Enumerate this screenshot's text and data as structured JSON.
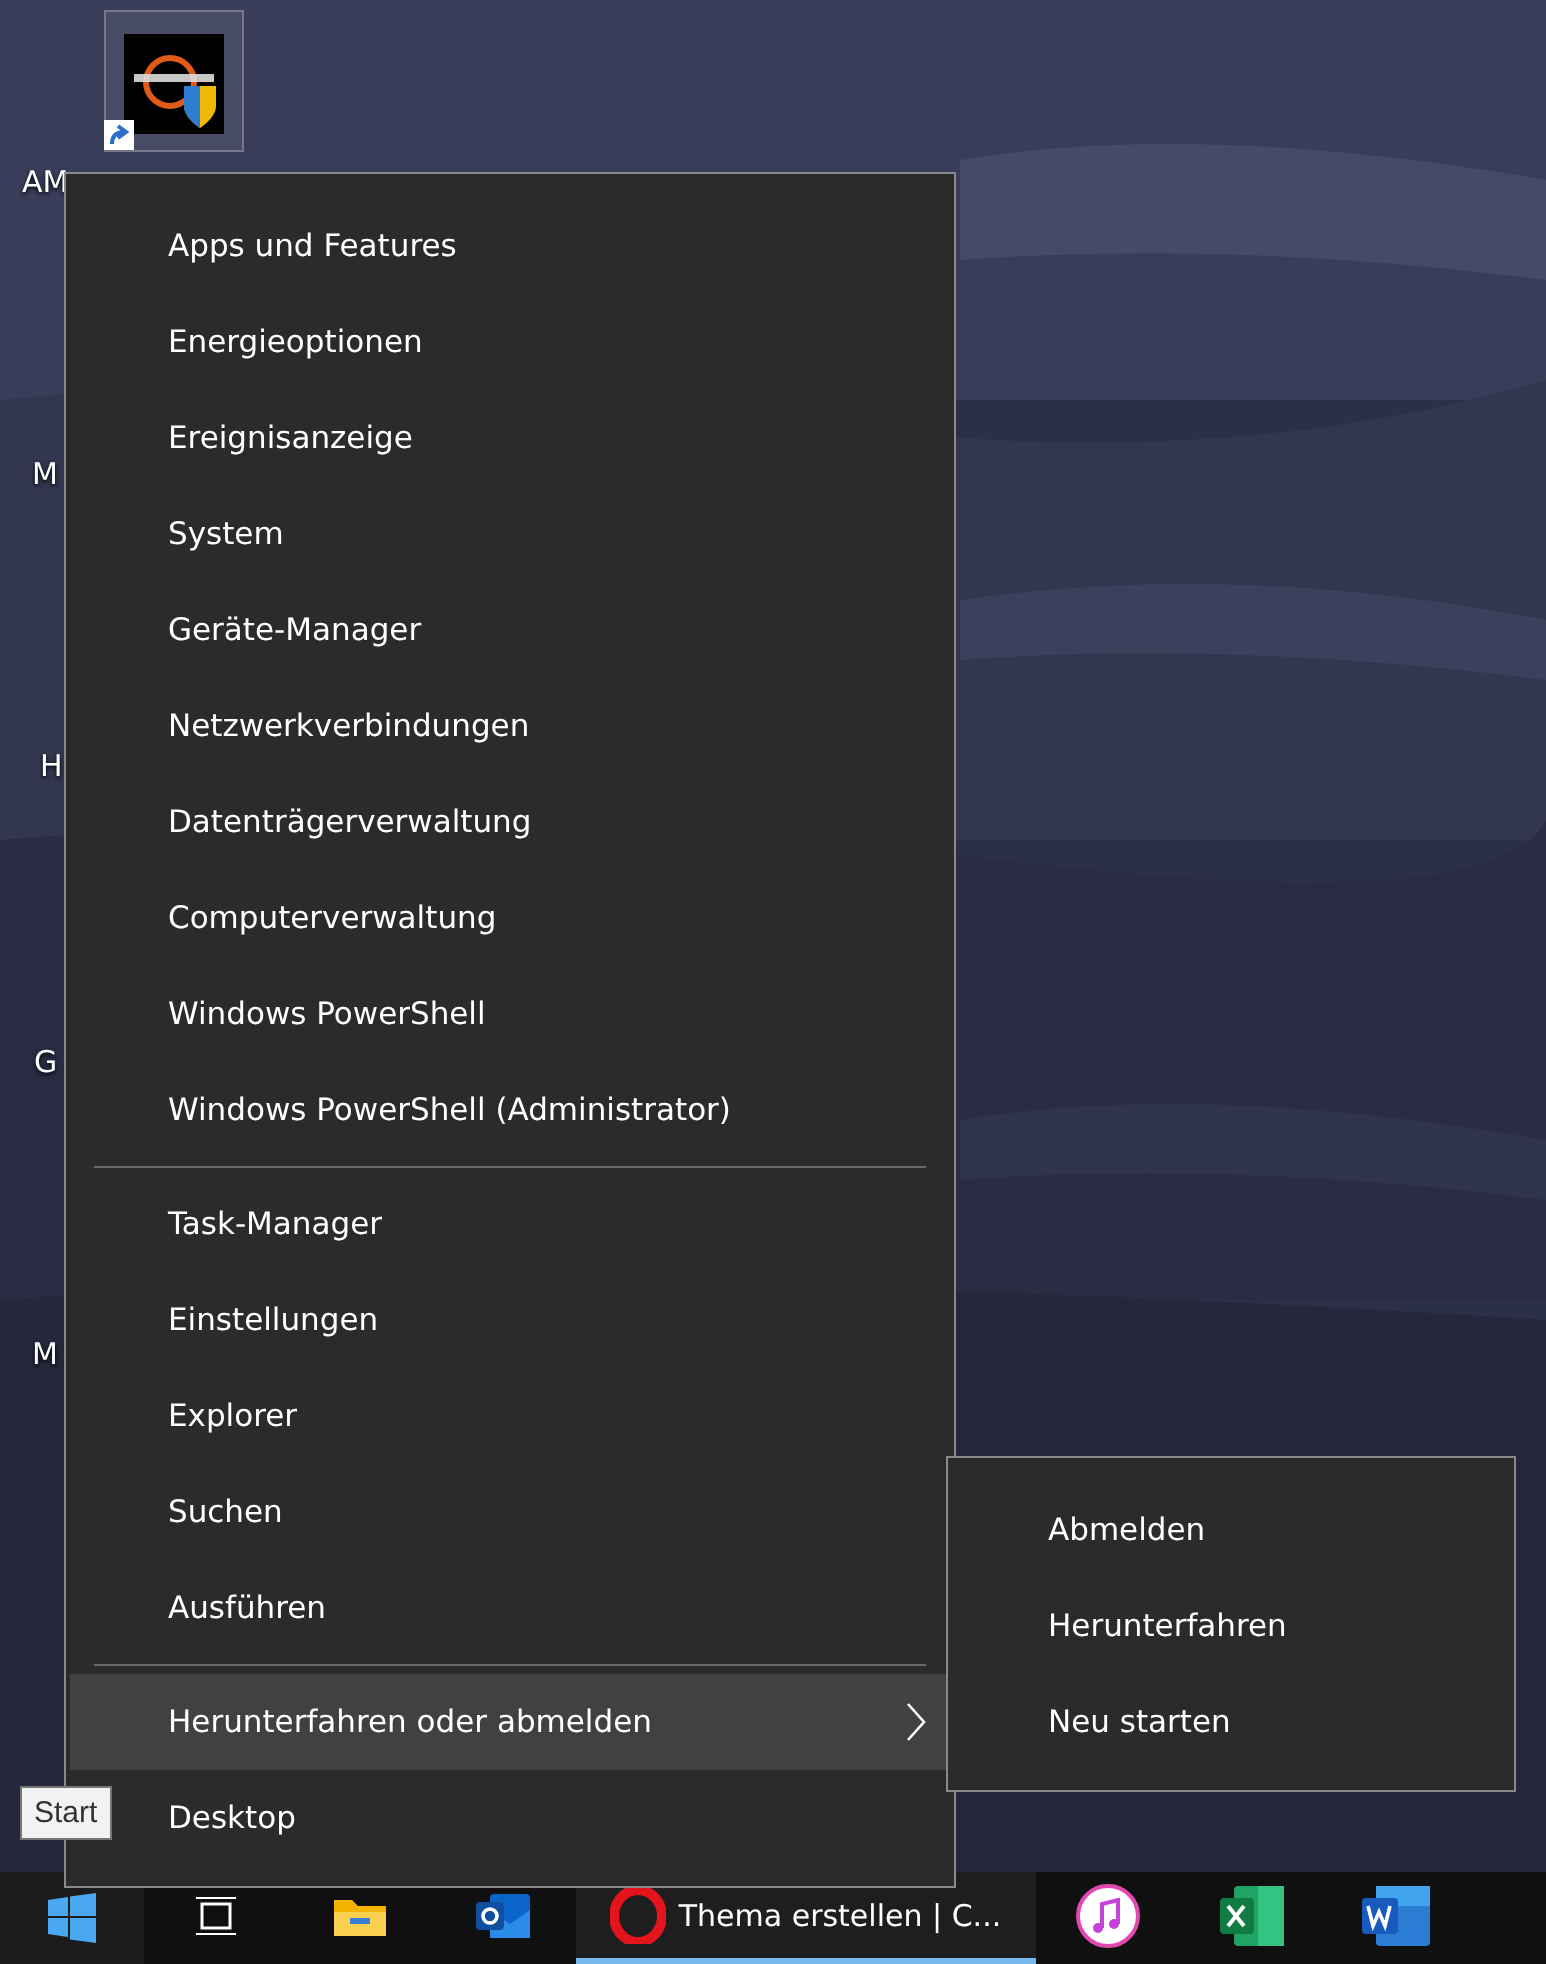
{
  "desktop": {
    "icon_labels": [
      {
        "label": "AM"
      },
      {
        "label": "M"
      },
      {
        "label": "H"
      },
      {
        "label": "G"
      },
      {
        "label": "M"
      }
    ],
    "shortcut_selected": true
  },
  "context_menu": {
    "groups": [
      {
        "items": [
          {
            "label": "Apps und Features",
            "selected": false,
            "has_submenu": false
          },
          {
            "label": "Energieoptionen",
            "selected": false,
            "has_submenu": false
          },
          {
            "label": "Ereignisanzeige",
            "selected": false,
            "has_submenu": false
          },
          {
            "label": "System",
            "selected": false,
            "has_submenu": false
          },
          {
            "label": "Geräte-Manager",
            "selected": false,
            "has_submenu": false
          },
          {
            "label": "Netzwerkverbindungen",
            "selected": false,
            "has_submenu": false
          },
          {
            "label": "Datenträgerverwaltung",
            "selected": false,
            "has_submenu": false
          },
          {
            "label": "Computerverwaltung",
            "selected": false,
            "has_submenu": false
          },
          {
            "label": "Windows PowerShell",
            "selected": false,
            "has_submenu": false
          },
          {
            "label": "Windows PowerShell (Administrator)",
            "selected": false,
            "has_submenu": false
          }
        ]
      },
      {
        "items": [
          {
            "label": "Task-Manager",
            "selected": false,
            "has_submenu": false
          },
          {
            "label": "Einstellungen",
            "selected": false,
            "has_submenu": false
          },
          {
            "label": "Explorer",
            "selected": false,
            "has_submenu": false
          },
          {
            "label": "Suchen",
            "selected": false,
            "has_submenu": false
          },
          {
            "label": "Ausführen",
            "selected": false,
            "has_submenu": false
          }
        ]
      },
      {
        "items": [
          {
            "label": "Herunterfahren oder abmelden",
            "selected": true,
            "has_submenu": true
          },
          {
            "label": "Desktop",
            "selected": false,
            "has_submenu": false
          }
        ]
      }
    ]
  },
  "submenu": {
    "items": [
      {
        "label": "Abmelden"
      },
      {
        "label": "Herunterfahren"
      },
      {
        "label": "Neu starten"
      }
    ]
  },
  "tooltip": {
    "text": "Start"
  },
  "taskbar": {
    "apps": [
      {
        "kind": "taskview",
        "active": false
      },
      {
        "kind": "explorer",
        "active": false
      },
      {
        "kind": "outlook",
        "active": false
      },
      {
        "kind": "opera",
        "active": true,
        "title": "Thema erstellen | C..."
      },
      {
        "kind": "itunes",
        "active": false
      },
      {
        "kind": "excel",
        "active": false
      },
      {
        "kind": "word",
        "active": false
      }
    ]
  }
}
